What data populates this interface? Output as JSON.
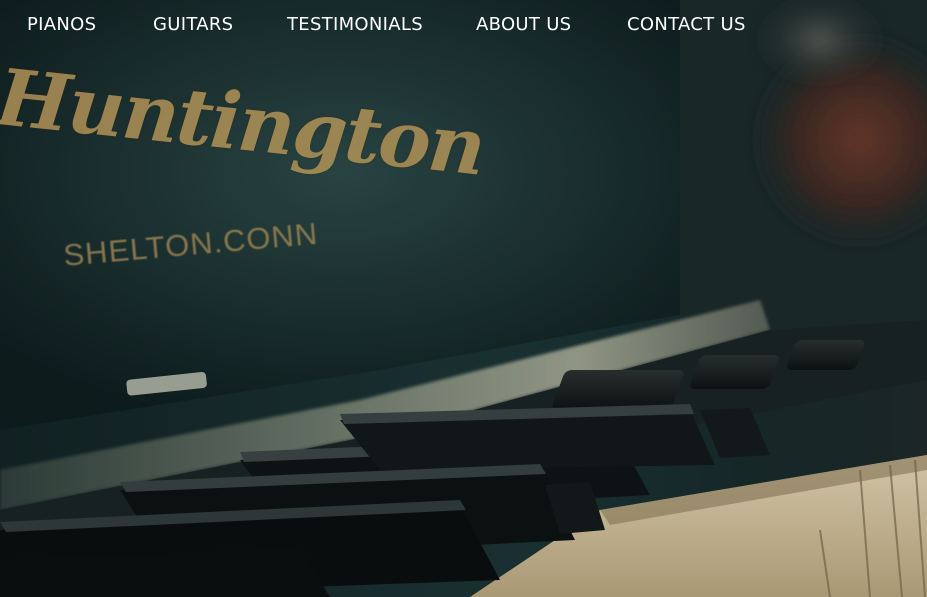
{
  "nav": {
    "items": [
      {
        "label": "PIANOS"
      },
      {
        "label": "GUITARS"
      },
      {
        "label": "TESTIMONIALS"
      },
      {
        "label": "ABOUT US"
      },
      {
        "label": "CONTACT US"
      }
    ]
  },
  "hero": {
    "brand_text": "Huntington",
    "brand_subtext": "SHELTON.CONN"
  },
  "colors": {
    "nav_text": "#ffffff",
    "background_dark": "#0d1a1c",
    "gilded_lettering": "#b69658",
    "ivory_keys": "#d9c9a4"
  }
}
